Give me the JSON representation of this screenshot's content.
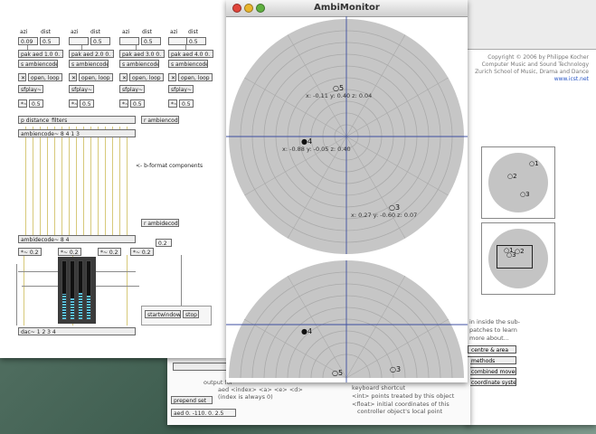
{
  "monitor": {
    "title": "AmbiMonitor",
    "top_points": [
      {
        "label": "5",
        "coord": "x: -0.11  y: 0.40  z: 0.04"
      },
      {
        "label": "4",
        "coord": "x: -0.88  y: -0.05  z: 0.40"
      },
      {
        "label": "3",
        "coord": "x: 0.27  y: -0.60  z: 0.07"
      }
    ],
    "bottom_points": [
      "4",
      "5",
      "3"
    ]
  },
  "patch": {
    "col_labels": [
      "azi",
      "dist",
      "azi",
      "dist",
      "azi",
      "dist",
      "azi",
      "dist"
    ],
    "num_boxes": [
      "0.09",
      "0.5",
      "",
      "0.5",
      "",
      "0.5",
      "",
      "0.5"
    ],
    "pak_boxes": [
      "pak aed 1.0 0. 1",
      "pak aed 2.0 0. 1",
      "pak aed 3.0 0. 1",
      "pak aed 4.0 0. 1"
    ],
    "ambiencode_small": [
      "s ambiencode",
      "s ambiencode",
      "s ambiencode",
      "s ambiencode"
    ],
    "open_loop": [
      "open, loop 1",
      "open, loop 1",
      "open, loop 1",
      "open, loop 1"
    ],
    "sfplay": [
      "sfplay~",
      "sfplay~",
      "sfplay~",
      "sfplay~"
    ],
    "level_vals": [
      "0.5",
      "0.5",
      "0.5",
      "0.5"
    ],
    "distance_filters": "p distance_filters",
    "r_ambiencode": "r ambiencode",
    "ambiencode_main": "ambiencode~ 8 4 1 3",
    "bformat_comment": "<- b-format components",
    "r_ambidecode": "r ambidecode",
    "ambidecode_main": "ambidecode~ 8 4",
    "gain_labels": [
      "*~ 0.2",
      "*~ 0.2",
      "*~ 0.2",
      "*~ 0.2"
    ],
    "gain_num": "0.2",
    "startwindow": "startwindow",
    "stop": "stop",
    "dac": "dac~ 1 2 3 4"
  },
  "info": {
    "credit": [
      "Copyright © 2006 by Philippe Kocher",
      "Computer Music and Sound Technology",
      "Zurich School of Music, Drama and Dance",
      "www.icst.net"
    ],
    "mini_points_a": [
      "1",
      "2",
      "3"
    ],
    "mini_points_b": [
      "1",
      "3",
      "2"
    ],
    "sub_text": [
      "in inside the sub-",
      "patches to learn",
      "more about..."
    ],
    "buttons": [
      "centre & area",
      "methods",
      "combined movements",
      "coordinate system"
    ]
  },
  "helpwin": {
    "patch_boxes": [
      "prepend set",
      "aed 0. -110. 0. 2.5"
    ],
    "texts": [
      "output for",
      "aed <index> <a> <e> <d>",
      "(index is always 0)",
      "keyboard shortcut",
      "<int> points treated by this object",
      "<float> initial coordinates of this",
      "controller object's local point"
    ]
  },
  "colors": {
    "disk": "#c6c6c6",
    "ring": "#a9a9a9",
    "axis": "#3c4fa0",
    "close": "#e0443a",
    "min": "#e9b52d",
    "max": "#5fb040"
  }
}
